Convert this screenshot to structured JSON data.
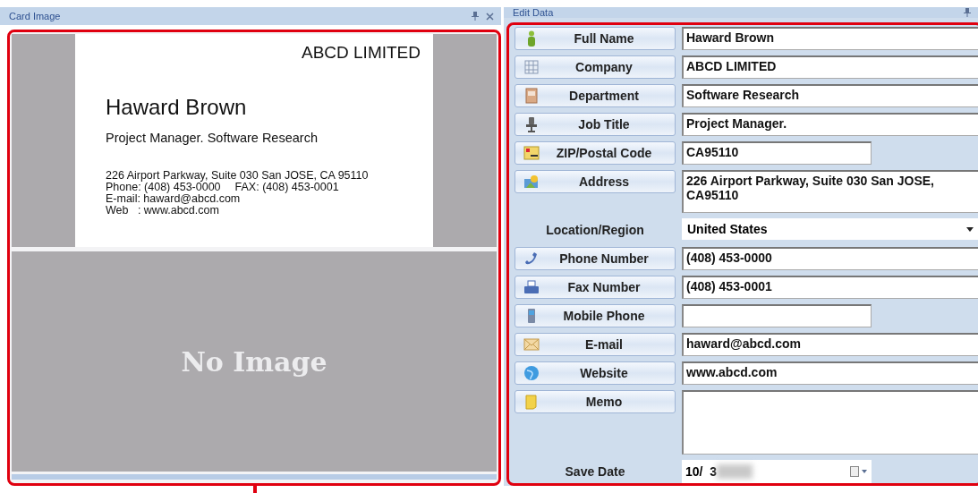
{
  "card_panel": {
    "title": "Card Image",
    "card": {
      "company": "ABCD LIMITED",
      "name": "Haward Brown",
      "position": "Project Manager. Software Research",
      "contact_lines": [
        [
          "226 Airport Parkway, Suite 030 San JOSE, CA 95110"
        ],
        [
          "Phone: (408) 453-0000",
          "FAX: (408) 453-0001"
        ],
        [
          "E-mail: haward@abcd.com"
        ],
        [
          "Web   : www.abcd.com"
        ]
      ]
    },
    "back_placeholder": "No Image"
  },
  "edit_panel": {
    "title": "Edit Data",
    "rows": [
      {
        "kind": "text",
        "label": "Full Name",
        "value": "Haward Brown"
      },
      {
        "kind": "text",
        "label": "Company",
        "value": "ABCD LIMITED"
      },
      {
        "kind": "text",
        "label": "Department",
        "value": "Software Research"
      },
      {
        "kind": "text",
        "label": "Job Title",
        "value": "Project Manager."
      },
      {
        "kind": "short-text",
        "label": "ZIP/Postal Code",
        "value": "CA95110"
      },
      {
        "kind": "textarea",
        "label": "Address",
        "value": "226 Airport Parkway, Suite 030 San JOSE, CA95110"
      },
      {
        "kind": "dropdown",
        "label": "Location/Region",
        "value": "United States"
      },
      {
        "kind": "text",
        "label": "Phone Number",
        "value": "(408) 453-0000"
      },
      {
        "kind": "text",
        "label": "Fax Number",
        "value": "(408) 453-0001"
      },
      {
        "kind": "short-text",
        "label": "Mobile Phone",
        "value": ""
      },
      {
        "kind": "text",
        "label": "E-mail",
        "value": "haward@abcd.com"
      },
      {
        "kind": "text",
        "label": "Website",
        "value": "www.abcd.com"
      },
      {
        "kind": "memo",
        "label": "Memo",
        "value": ""
      },
      {
        "kind": "date",
        "label": "Save Date",
        "value": "10/  3"
      }
    ]
  }
}
